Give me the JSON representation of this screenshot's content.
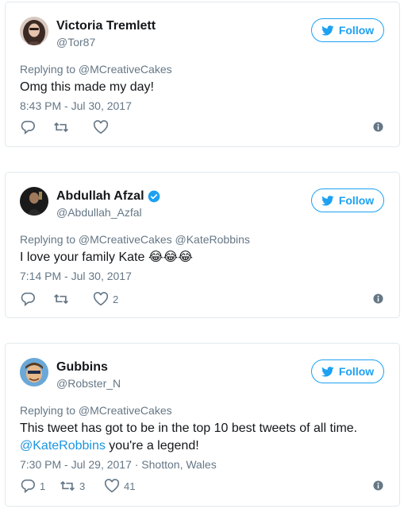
{
  "tweets": [
    {
      "name": "Victoria Tremlett",
      "handle": "@Tor87",
      "verified": false,
      "follow_label": "Follow",
      "replying_to": "Replying to @MCreativeCakes",
      "text": "Omg this made my day!",
      "time": "8:43 PM - Jul 30, 2017",
      "replies": "",
      "retweets": "",
      "likes": ""
    },
    {
      "name": "Abdullah Afzal",
      "handle": "@Abdullah_Azfal",
      "verified": true,
      "follow_label": "Follow",
      "replying_to": "Replying to @MCreativeCakes @KateRobbins",
      "text": "I love your family Kate",
      "emoji": "😂😂😂",
      "time": "7:14 PM - Jul 30, 2017",
      "replies": "",
      "retweets": "",
      "likes": "2"
    },
    {
      "name": "Gubbins",
      "handle": "@Robster_N",
      "verified": false,
      "follow_label": "Follow",
      "replying_to": "Replying to @MCreativeCakes",
      "text_line1": "This tweet has got to be in the top 10 best tweets of all time.",
      "text_mention": "@KateRobbins",
      "text_line2": " you're a legend!",
      "time": "7:30 PM - Jul 29, 2017 · Shotton, Wales",
      "replies": "1",
      "retweets": "3",
      "likes": "41"
    }
  ],
  "icons": {
    "follow": "twitter-bird-icon",
    "reply": "reply-icon",
    "retweet": "retweet-icon",
    "like": "heart-icon",
    "info": "info-icon",
    "verified": "verified-badge-icon"
  },
  "colors": {
    "accent": "#1da1f2",
    "secondary_text": "#657786",
    "border": "#e1e8ed"
  }
}
